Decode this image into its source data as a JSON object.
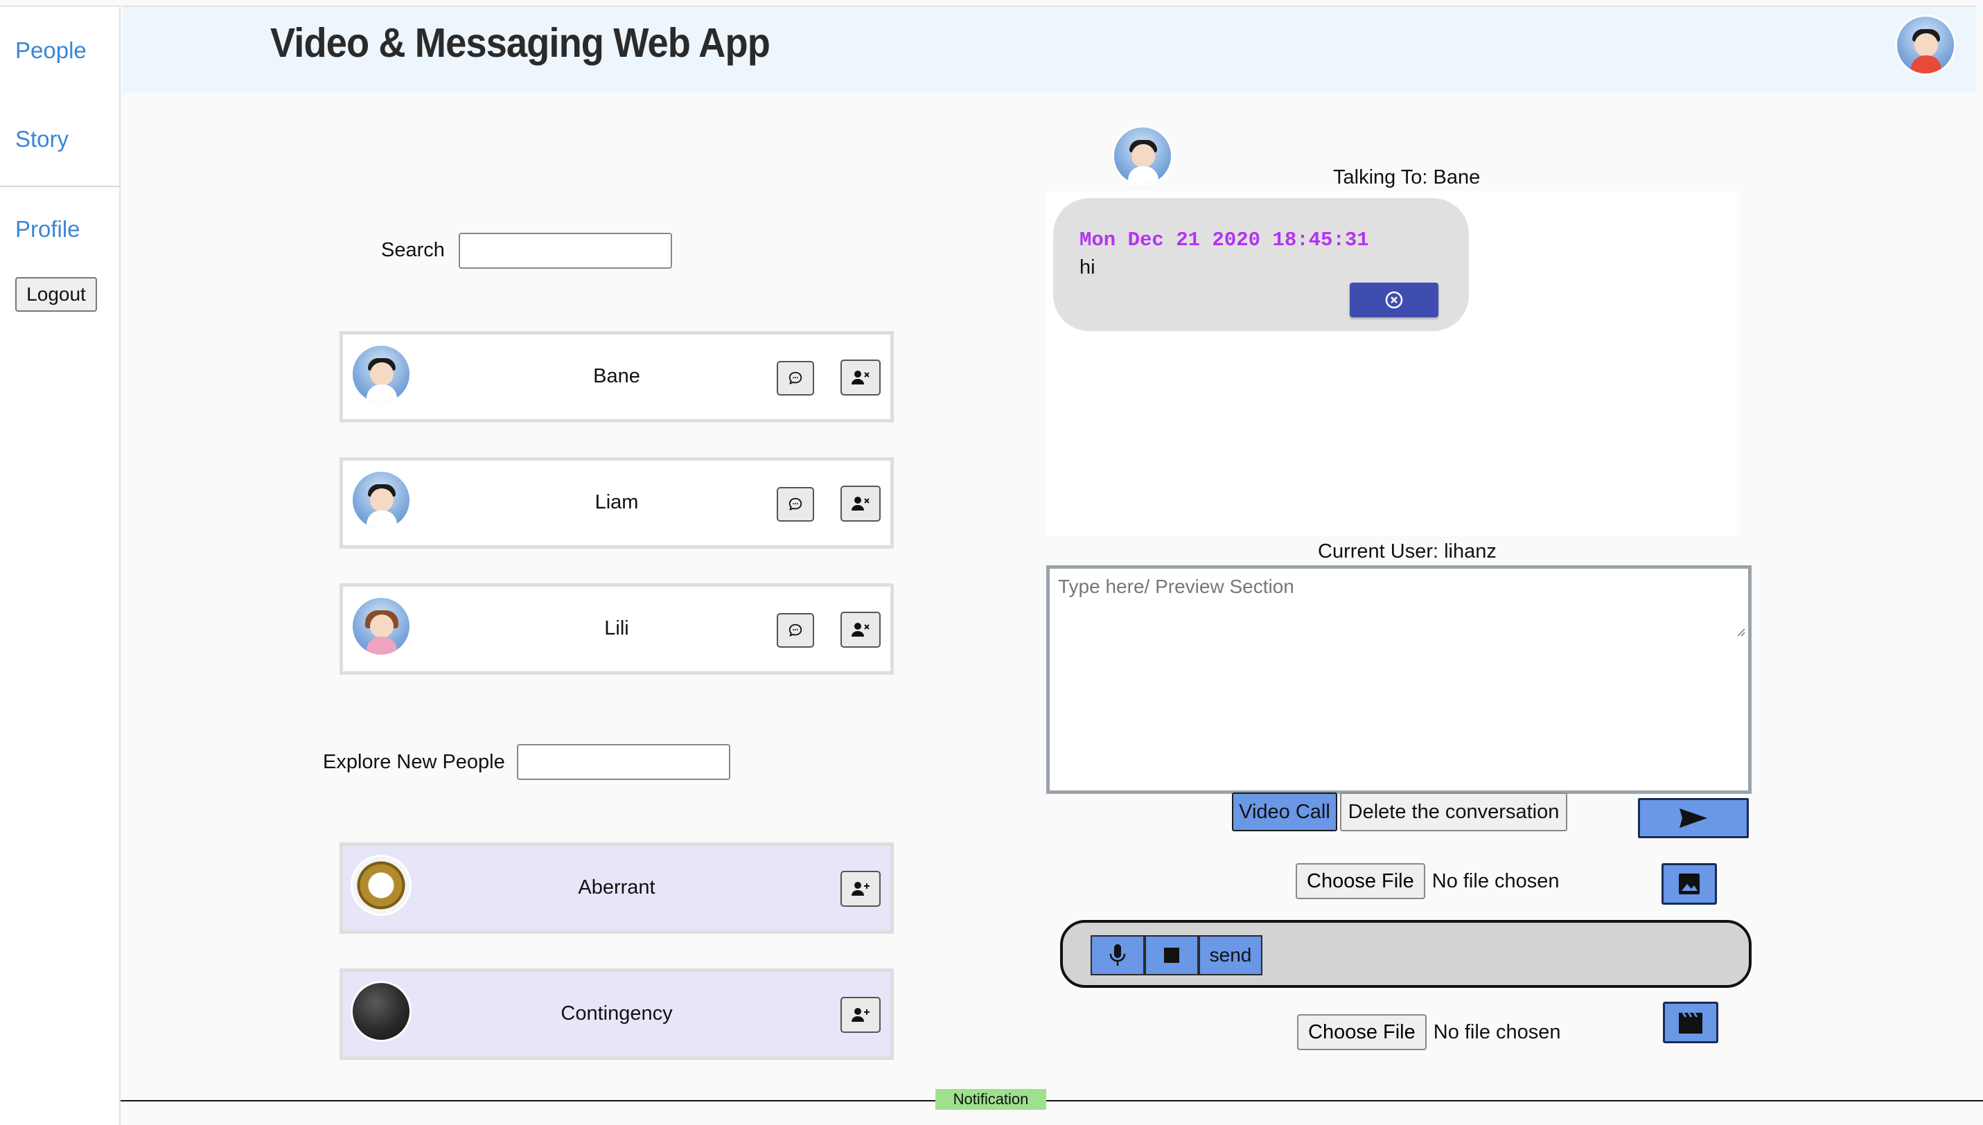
{
  "app": {
    "title": "Video & Messaging Web App"
  },
  "sidebar": {
    "items": [
      {
        "label": "People"
      },
      {
        "label": "Story"
      },
      {
        "label": "Profile"
      }
    ],
    "logout_label": "Logout"
  },
  "friends": {
    "search_label": "Search",
    "search_value": "",
    "list": [
      {
        "name": "Bane",
        "avatar": "boy-avatar"
      },
      {
        "name": "Liam",
        "avatar": "boy-avatar"
      },
      {
        "name": "Lili",
        "avatar": "girl-avatar"
      }
    ]
  },
  "explore": {
    "label": "Explore New People",
    "value": "",
    "list": [
      {
        "name": "Aberrant",
        "avatar": "ring-image"
      },
      {
        "name": "Contingency",
        "avatar": "dark-image"
      }
    ]
  },
  "chat": {
    "talking_to": "Talking To: Bane",
    "messages": [
      {
        "timestamp": "Mon Dec 21 2020 18:45:31",
        "text": "hi"
      }
    ],
    "current_user": "Current User: lihanz",
    "compose_placeholder": "Type here/ Preview Section",
    "video_call_label": "Video Call",
    "delete_conversation_label": "Delete the conversation",
    "image_file": {
      "button_label": "Choose File",
      "status": "No file chosen"
    },
    "video_file": {
      "button_label": "Choose File",
      "status": "No file chosen"
    },
    "recorder": {
      "send_label": "send"
    }
  },
  "footer": {
    "notification_label": "Notification"
  },
  "colors": {
    "accent": "#6a97e6",
    "link": "#3a85d8",
    "timestamp": "#b433f0",
    "delete_message": "#3f4db0",
    "notification": "#9ee08e",
    "header_bg": "#edf5fd",
    "explore_card_bg": "#e6e6f8"
  }
}
